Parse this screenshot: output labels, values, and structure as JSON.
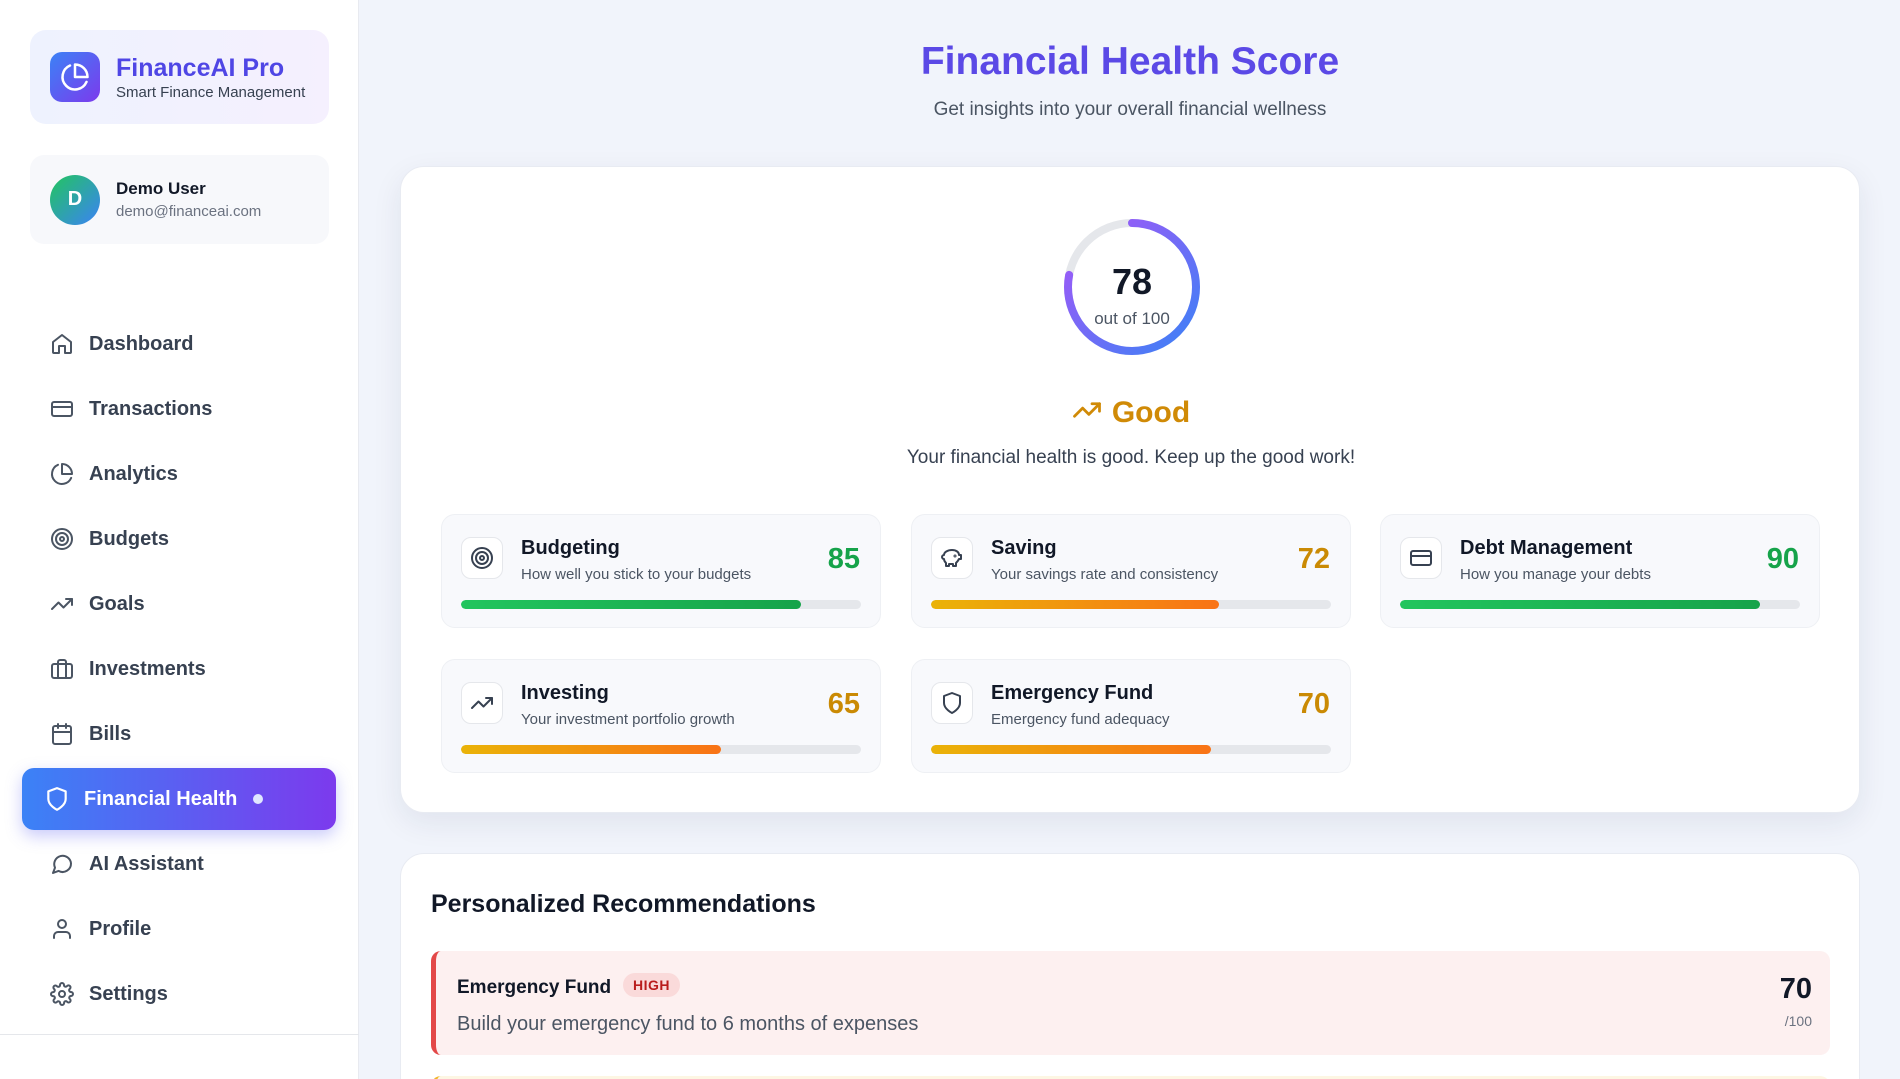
{
  "brand": {
    "name": "FinanceAI Pro",
    "tagline": "Smart Finance Management",
    "logo_icon": "pie-chart-icon"
  },
  "user": {
    "initial": "D",
    "name": "Demo User",
    "email": "demo@financeai.com"
  },
  "nav": [
    {
      "label": "Dashboard",
      "icon": "home-icon",
      "active": false
    },
    {
      "label": "Transactions",
      "icon": "credit-card-icon",
      "active": false
    },
    {
      "label": "Analytics",
      "icon": "pie-chart-icon",
      "active": false
    },
    {
      "label": "Budgets",
      "icon": "target-icon",
      "active": false
    },
    {
      "label": "Goals",
      "icon": "trending-up-icon",
      "active": false
    },
    {
      "label": "Investments",
      "icon": "briefcase-icon",
      "active": false
    },
    {
      "label": "Bills",
      "icon": "calendar-icon",
      "active": false
    },
    {
      "label": "Financial Health",
      "icon": "shield-icon",
      "active": true
    },
    {
      "label": "AI Assistant",
      "icon": "chat-bubble-icon",
      "active": false
    },
    {
      "label": "Profile",
      "icon": "user-icon",
      "active": false
    },
    {
      "label": "Settings",
      "icon": "gear-icon",
      "active": false
    }
  ],
  "header": {
    "title": "Financial Health Score",
    "subtitle": "Get insights into your overall financial wellness"
  },
  "score": {
    "value": "78",
    "out_of": "out of 100",
    "fraction": 0.78,
    "status_label": "Good",
    "status_icon": "trending-up-icon",
    "status_color": "#d08a06",
    "message": "Your financial health is good. Keep up the good work!"
  },
  "metrics": [
    {
      "title": "Budgeting",
      "desc": "How well you stick to your budgets",
      "score": "85",
      "fraction": 0.85,
      "icon": "target-icon",
      "color": "#16a34a",
      "fill": "green"
    },
    {
      "title": "Saving",
      "desc": "Your savings rate and consistency",
      "score": "72",
      "fraction": 0.72,
      "icon": "piggy-bank-icon",
      "color": "#ca8a04",
      "fill": "amber"
    },
    {
      "title": "Debt Management",
      "desc": "How you manage your debts",
      "score": "90",
      "fraction": 0.9,
      "icon": "credit-card-icon",
      "color": "#16a34a",
      "fill": "green"
    },
    {
      "title": "Investing",
      "desc": "Your investment portfolio growth",
      "score": "65",
      "fraction": 0.65,
      "icon": "trending-up-icon",
      "color": "#ca8a04",
      "fill": "amber"
    },
    {
      "title": "Emergency Fund",
      "desc": "Emergency fund adequacy",
      "score": "70",
      "fraction": 0.7,
      "icon": "shield-icon",
      "color": "#ca8a04",
      "fill": "amber"
    }
  ],
  "recommendations": {
    "title": "Personalized Recommendations",
    "items": [
      {
        "title": "Emergency Fund",
        "priority": "HIGH",
        "desc": "Build your emergency fund to 6 months of expenses",
        "score": "70",
        "max": "/100"
      }
    ]
  }
}
